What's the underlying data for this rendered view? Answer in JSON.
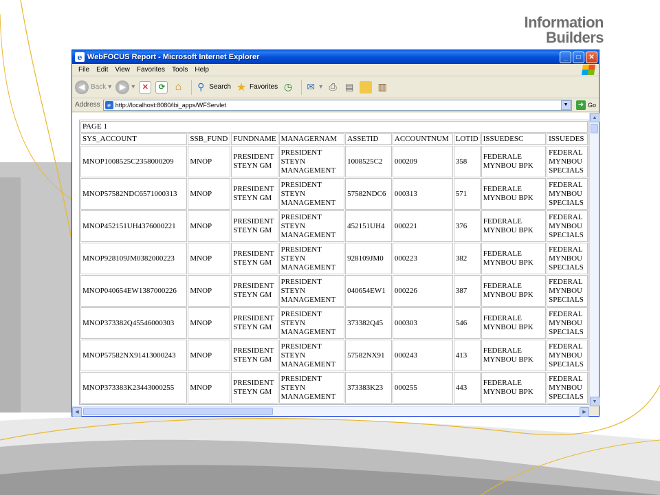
{
  "logo": {
    "line1": "Information",
    "line2": "Builders"
  },
  "window": {
    "title": "WebFOCUS Report - Microsoft Internet Explorer",
    "controls": {
      "minimize": "_",
      "maximize": "□",
      "close": "✕"
    }
  },
  "menu": [
    "File",
    "Edit",
    "View",
    "Favorites",
    "Tools",
    "Help"
  ],
  "toolbar": {
    "back": "Back",
    "search": "Search",
    "favorites": "Favorites"
  },
  "address": {
    "label": "Address",
    "url": "http://localhost:8080/ibi_apps/WFServlet",
    "go": "Go"
  },
  "report": {
    "page_label": "PAGE 1",
    "columns": [
      "SYS_ACCOUNT",
      "SSB_FUND",
      "FUNDNAME",
      "MANAGERNAM",
      "ASSETID",
      "ACCOUNTNUM",
      "LOTID",
      "ISSUEDESC",
      "ISSUEDES"
    ],
    "rows": [
      [
        "MNOP1008525C2358000209",
        "MNOP",
        "PRESIDENT STEYN GM",
        "PRESIDENT STEYN MANAGEMENT",
        "1008525C2",
        "000209",
        "358",
        "FEDERALE MYNBOU BPK",
        "FEDERAL MYNBOU SPECIALS"
      ],
      [
        "MNOP57582NDC6571000313",
        "MNOP",
        "PRESIDENT STEYN GM",
        "PRESIDENT STEYN MANAGEMENT",
        "57582NDC6",
        "000313",
        "571",
        "FEDERALE MYNBOU BPK",
        "FEDERAL MYNBOU SPECIALS"
      ],
      [
        "MNOP452151UH4376000221",
        "MNOP",
        "PRESIDENT STEYN GM",
        "PRESIDENT STEYN MANAGEMENT",
        "452151UH4",
        "000221",
        "376",
        "FEDERALE MYNBOU BPK",
        "FEDERAL MYNBOU SPECIALS"
      ],
      [
        "MNOP928109JM0382000223",
        "MNOP",
        "PRESIDENT STEYN GM",
        "PRESIDENT STEYN MANAGEMENT",
        "928109JM0",
        "000223",
        "382",
        "FEDERALE MYNBOU BPK",
        "FEDERAL MYNBOU SPECIALS"
      ],
      [
        "MNOP040654EW1387000226",
        "MNOP",
        "PRESIDENT STEYN GM",
        "PRESIDENT STEYN MANAGEMENT",
        "040654EW1",
        "000226",
        "387",
        "FEDERALE MYNBOU BPK",
        "FEDERAL MYNBOU SPECIALS"
      ],
      [
        "MNOP373382Q45546000303",
        "MNOP",
        "PRESIDENT STEYN GM",
        "PRESIDENT STEYN MANAGEMENT",
        "373382Q45",
        "000303",
        "546",
        "FEDERALE MYNBOU BPK",
        "FEDERAL MYNBOU SPECIALS"
      ],
      [
        "MNOP57582NX91413000243",
        "MNOP",
        "PRESIDENT STEYN GM",
        "PRESIDENT STEYN MANAGEMENT",
        "57582NX91",
        "000243",
        "413",
        "FEDERALE MYNBOU BPK",
        "FEDERAL MYNBOU SPECIALS"
      ],
      [
        "MNOP373383K23443000255",
        "MNOP",
        "PRESIDENT STEYN GM",
        "PRESIDENT STEYN MANAGEMENT",
        "373383K23",
        "000255",
        "443",
        "FEDERALE MYNBOU BPK",
        "FEDERAL MYNBOU SPECIALS"
      ]
    ]
  },
  "colors": {
    "title_bar": "#0450d8",
    "slide_band": "#bcbcbc",
    "slide_line": "#e8b830"
  }
}
